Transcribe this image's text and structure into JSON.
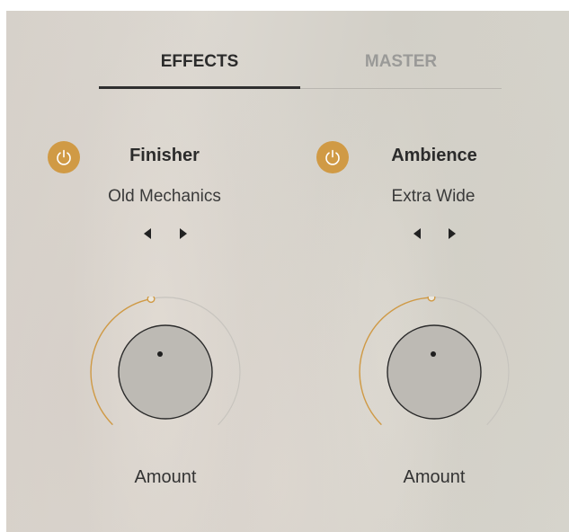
{
  "tabs": [
    {
      "label": "EFFECTS",
      "active": true
    },
    {
      "label": "MASTER",
      "active": false
    }
  ],
  "effects": [
    {
      "name": "Finisher",
      "preset": "Old Mechanics",
      "enabled": true,
      "power_icon": "power-icon",
      "prev_icon": "triangle-left-icon",
      "next_icon": "triangle-right-icon",
      "knob_label": "Amount",
      "amount": 0.5
    },
    {
      "name": "Ambience",
      "preset": "Extra Wide",
      "enabled": true,
      "power_icon": "power-icon",
      "prev_icon": "triangle-left-icon",
      "next_icon": "triangle-right-icon",
      "knob_label": "Amount",
      "amount": 0.5
    }
  ],
  "colors": {
    "accent": "#d09a45",
    "text_primary": "#2b2b2b",
    "text_inactive": "#9a9a98",
    "knob_face": "#bdbab4"
  }
}
